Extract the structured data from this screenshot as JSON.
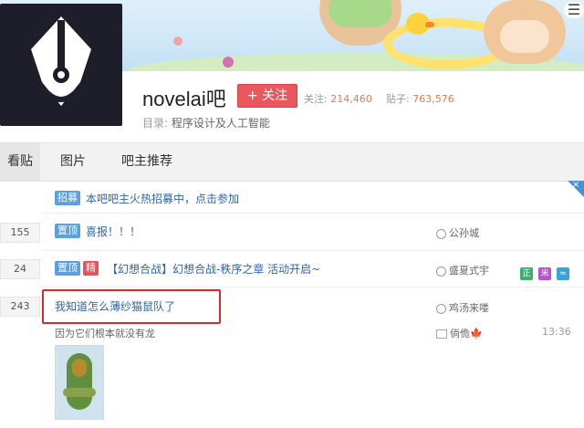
{
  "menu_glyph": "☰",
  "forum": {
    "name": "novelai吧",
    "follow_label": "+ 关注",
    "followers_label": "关注:",
    "followers": "214,460",
    "posts_label": "贴子:",
    "posts": "763,576",
    "directory_label": "目录:",
    "directory_value": "程序设计及人工智能"
  },
  "tabs": [
    {
      "label": "看贴",
      "active": true
    },
    {
      "label": "图片",
      "active": false
    },
    {
      "label": "吧主推荐",
      "active": false
    }
  ],
  "close_glyph": "×",
  "recruit": {
    "badge": "招募",
    "text": "本吧吧主火热招募中，点击参加"
  },
  "threads": [
    {
      "count": "155",
      "badges": [
        "置顶"
      ],
      "title": "喜报！！！",
      "author": "公孙城"
    },
    {
      "count": "24",
      "badges": [
        "置顶",
        "精"
      ],
      "title": "【幻想合战】幻想合战-秩序之章 活动开启~",
      "author": "盛夏式宇",
      "tags": [
        "正",
        "米",
        "≈"
      ]
    },
    {
      "count": "243",
      "badges": [],
      "title": "我知道怎么薄纱猫鼠队了",
      "author": "鸡汤来喽",
      "excerpt": "因为它们根本就没有龙",
      "last_reply": "倘佹",
      "last_reply_suffix": "🍁",
      "time": "13:36"
    }
  ],
  "colors": {
    "accent": "#e8585c",
    "link": "#2d64b3",
    "highlight": "#d9272e",
    "badge_blue": "#5b9fde",
    "badge_red": "#e0555e"
  }
}
